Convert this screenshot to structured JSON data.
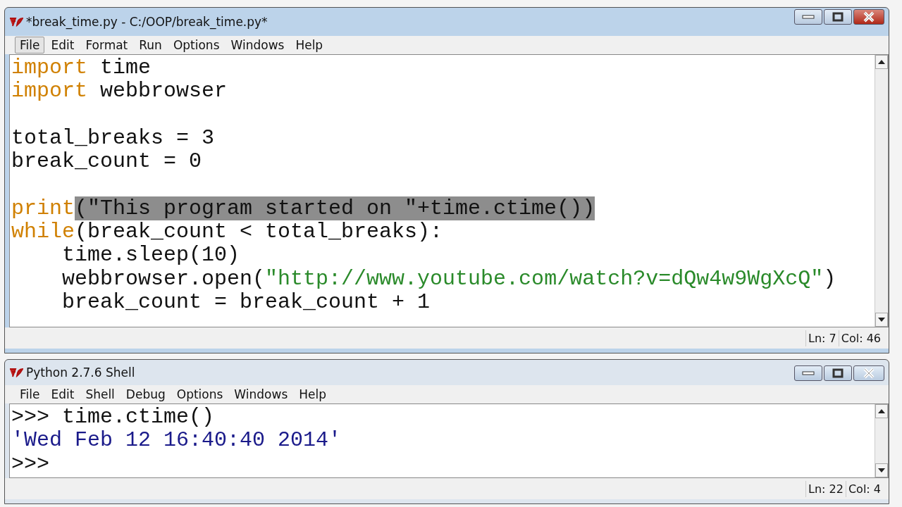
{
  "editor": {
    "title": "*break_time.py - C:/OOP/break_time.py*",
    "menu": [
      {
        "label": "File",
        "hovered": true
      },
      {
        "label": "Edit",
        "hovered": false
      },
      {
        "label": "Format",
        "hovered": false
      },
      {
        "label": "Run",
        "hovered": false
      },
      {
        "label": "Options",
        "hovered": false
      },
      {
        "label": "Windows",
        "hovered": false
      },
      {
        "label": "Help",
        "hovered": false
      }
    ],
    "lines": [
      {
        "kind": "code",
        "tokens": [
          {
            "kind": "keyword",
            "text": "import"
          },
          {
            "kind": "plain",
            "text": " time"
          }
        ]
      },
      {
        "kind": "code",
        "tokens": [
          {
            "kind": "keyword",
            "text": "import"
          },
          {
            "kind": "plain",
            "text": " webbrowser"
          }
        ]
      },
      {
        "kind": "blank"
      },
      {
        "kind": "code",
        "tokens": [
          {
            "kind": "plain",
            "text": "total_breaks = 3"
          }
        ]
      },
      {
        "kind": "code",
        "tokens": [
          {
            "kind": "plain",
            "text": "break_count = 0"
          }
        ]
      },
      {
        "kind": "blank"
      },
      {
        "kind": "code",
        "tokens": [
          {
            "kind": "keyword",
            "text": "print"
          },
          {
            "kind": "selected",
            "text": "(\"This program started on \"+time.ctime())"
          }
        ]
      },
      {
        "kind": "code",
        "tokens": [
          {
            "kind": "keyword",
            "text": "while"
          },
          {
            "kind": "plain",
            "text": "(break_count < total_breaks):"
          }
        ]
      },
      {
        "kind": "code",
        "tokens": [
          {
            "kind": "plain",
            "text": "    time.sleep(10)"
          }
        ]
      },
      {
        "kind": "code",
        "tokens": [
          {
            "kind": "plain",
            "text": "    webbrowser.open("
          },
          {
            "kind": "string",
            "text": "\"http://www.youtube.com/watch?v=dQw4w9WgXcQ\""
          },
          {
            "kind": "plain",
            "text": ")"
          }
        ]
      },
      {
        "kind": "code",
        "tokens": [
          {
            "kind": "plain",
            "text": "    break_count = break_count + 1"
          }
        ]
      }
    ],
    "status": {
      "line": "Ln: 7",
      "col": "Col: 46"
    }
  },
  "shell": {
    "title": "Python 2.7.6 Shell",
    "menu": [
      {
        "label": "File",
        "hovered": false
      },
      {
        "label": "Edit",
        "hovered": false
      },
      {
        "label": "Shell",
        "hovered": false
      },
      {
        "label": "Debug",
        "hovered": false
      },
      {
        "label": "Options",
        "hovered": false
      },
      {
        "label": "Windows",
        "hovered": false
      },
      {
        "label": "Help",
        "hovered": false
      }
    ],
    "lines": [
      {
        "kind": "code",
        "tokens": [
          {
            "kind": "plain",
            "text": ">>> time.ctime()"
          }
        ]
      },
      {
        "kind": "code",
        "tokens": [
          {
            "kind": "output",
            "text": "'Wed Feb 12 16:40:40 2014'"
          }
        ]
      },
      {
        "kind": "code",
        "tokens": [
          {
            "kind": "plain",
            "text": ">>>"
          }
        ]
      }
    ],
    "status": {
      "line": "Ln: 22",
      "col": "Col: 4"
    }
  }
}
